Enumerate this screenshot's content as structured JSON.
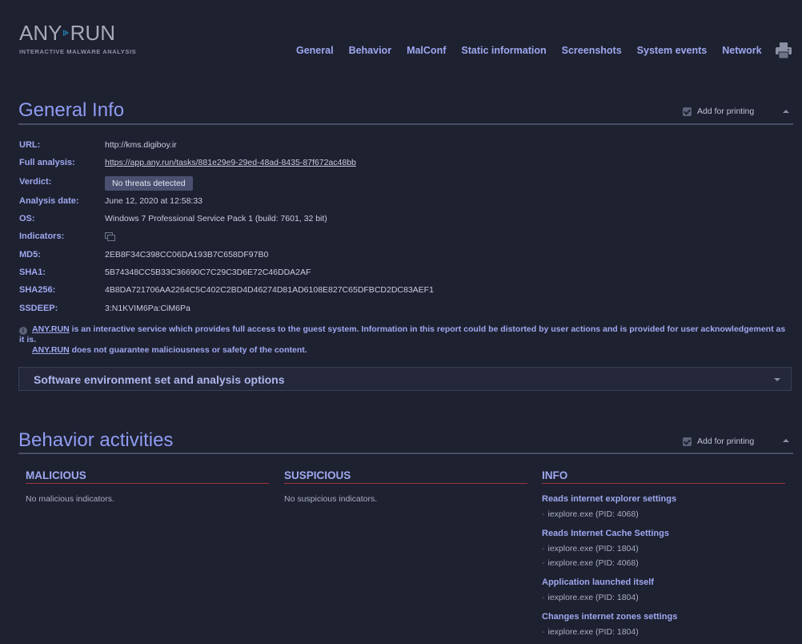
{
  "logo": {
    "left_word": "ANY",
    "right_word": "RUN",
    "tagline": "INTERACTIVE MALWARE ANALYSIS"
  },
  "nav": [
    "General",
    "Behavior",
    "MalConf",
    "Static information",
    "Screenshots",
    "System events",
    "Network"
  ],
  "general": {
    "title": "General Info",
    "print_label": "Add for printing",
    "labels": {
      "url": "URL:",
      "full": "Full analysis:",
      "verdict": "Verdict:",
      "date": "Analysis date:",
      "os": "OS:",
      "indicators": "Indicators:",
      "md5": "MD5:",
      "sha1": "SHA1:",
      "sha256": "SHA256:",
      "ssdeep": "SSDEEP:"
    },
    "values": {
      "url": "http://kms.digiboy.ir",
      "full": "https://app.any.run/tasks/881e29e9-29ed-48ad-8435-87f672ac48bb",
      "verdict": "No threats detected",
      "date": "June 12, 2020 at 12:58:33",
      "os": "Windows 7 Professional Service Pack 1 (build: 7601, 32 bit)",
      "md5": "2EB8F34C398CC06DA193B7C658DF97B0",
      "sha1": "5B74348CC5B33C36690C7C29C3D6E72C46DDA2AF",
      "sha256": "4B8DA721706AA2264C5C402C2BD4D46274D81AD6108E827C65DFBCD2DC83AEF1",
      "ssdeep": "3:N1KVIM6Pa:CiM6Pa"
    },
    "notice": {
      "brand": "ANY.RUN",
      "line1": " is an interactive service which provides full access to the guest system. Information in this report could be distorted by user actions and is provided for user acknowledgement as it is.",
      "line2": " does not guarantee maliciousness or safety of the content."
    },
    "software_bar": "Software environment set and analysis options"
  },
  "behavior": {
    "title": "Behavior activities",
    "print_label": "Add for printing",
    "malicious": {
      "head": "MALICIOUS",
      "empty": "No malicious indicators."
    },
    "suspicious": {
      "head": "SUSPICIOUS",
      "empty": "No suspicious indicators."
    },
    "info": {
      "head": "INFO",
      "events": [
        {
          "title": "Reads internet explorer settings",
          "procs": [
            "iexplore.exe (PID: 4068)"
          ]
        },
        {
          "title": "Reads Internet Cache Settings",
          "procs": [
            "iexplore.exe (PID: 1804)",
            "iexplore.exe (PID: 4068)"
          ]
        },
        {
          "title": "Application launched itself",
          "procs": [
            "iexplore.exe (PID: 1804)"
          ]
        },
        {
          "title": "Changes internet zones settings",
          "procs": [
            "iexplore.exe (PID: 1804)"
          ]
        }
      ]
    }
  }
}
